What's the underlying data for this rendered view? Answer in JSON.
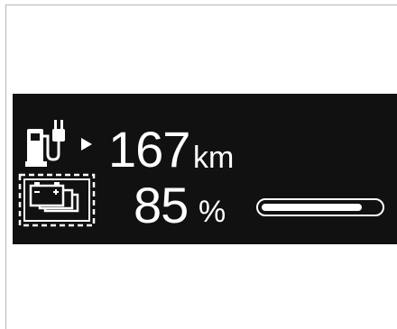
{
  "display": {
    "range_value": "167",
    "range_unit": "km",
    "range_icon": "fuel-pump-plug-arrow-icon",
    "soc_value": "85",
    "soc_unit": "%",
    "soc_fraction": 0.85,
    "battery_icon": "battery-stack-icon"
  },
  "colors": {
    "background": "#111111",
    "foreground": "#ffffff",
    "page": "#ffffff"
  }
}
